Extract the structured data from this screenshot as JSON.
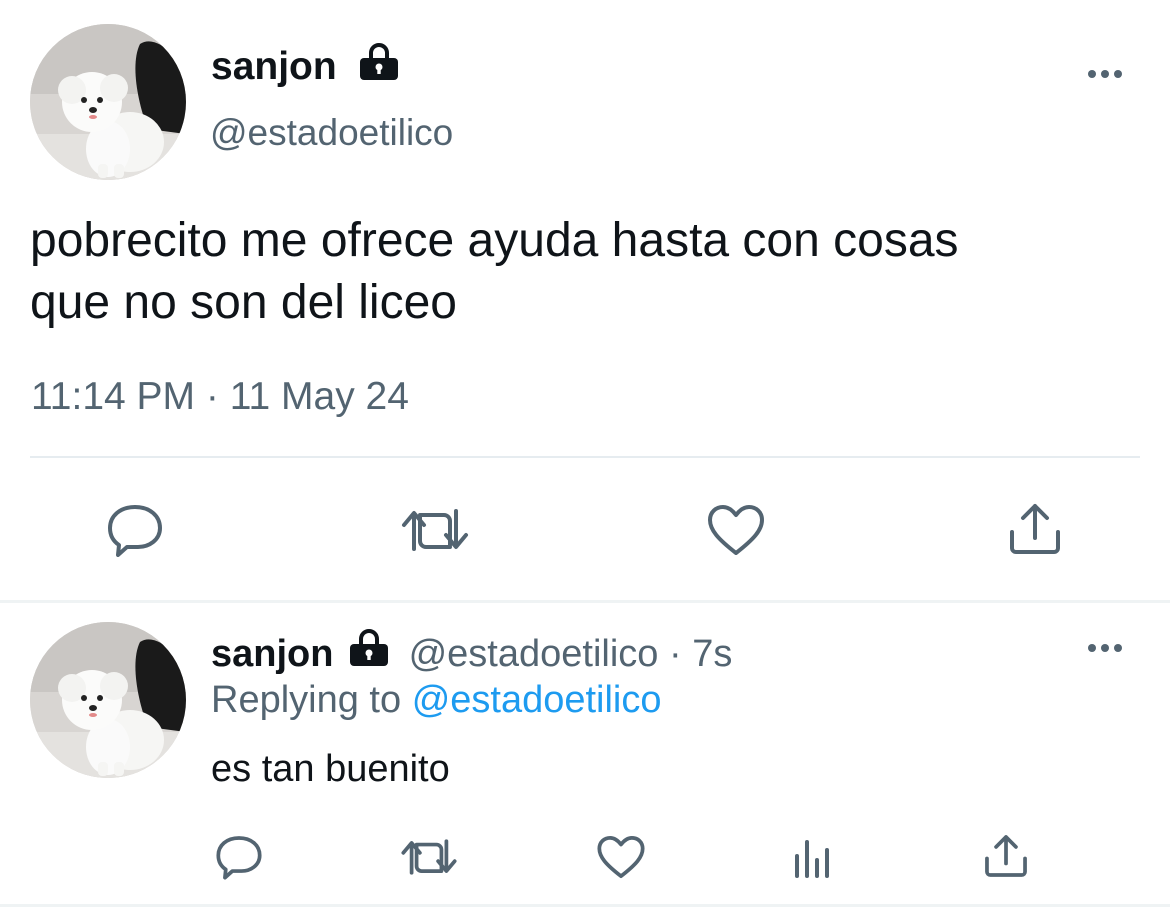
{
  "main_tweet": {
    "display_name": "sanjon",
    "handle": "@estadoetilico",
    "text_line1": "pobrecito me ofrece ayuda hasta con cosas",
    "text_line2": "que no son del liceo",
    "timestamp": "11:14 PM · 11 May 24",
    "icons": [
      "lock-icon",
      "more-icon",
      "reply-icon",
      "retweet-icon",
      "like-icon",
      "share-icon"
    ]
  },
  "reply_tweet": {
    "display_name": "sanjon",
    "handle": "@estadoetilico",
    "separator": "·",
    "time_ago": "7s",
    "replying_prefix": "Replying to",
    "replying_handle": "@estadoetilico",
    "text": "es tan buenito",
    "icons": [
      "lock-icon",
      "more-icon",
      "reply-icon",
      "retweet-icon",
      "like-icon",
      "analytics-icon",
      "share-icon"
    ]
  },
  "colors": {
    "text": "#0f1419",
    "muted": "#536471",
    "link": "#1d9bf0",
    "divider": "#e6ecf0"
  }
}
